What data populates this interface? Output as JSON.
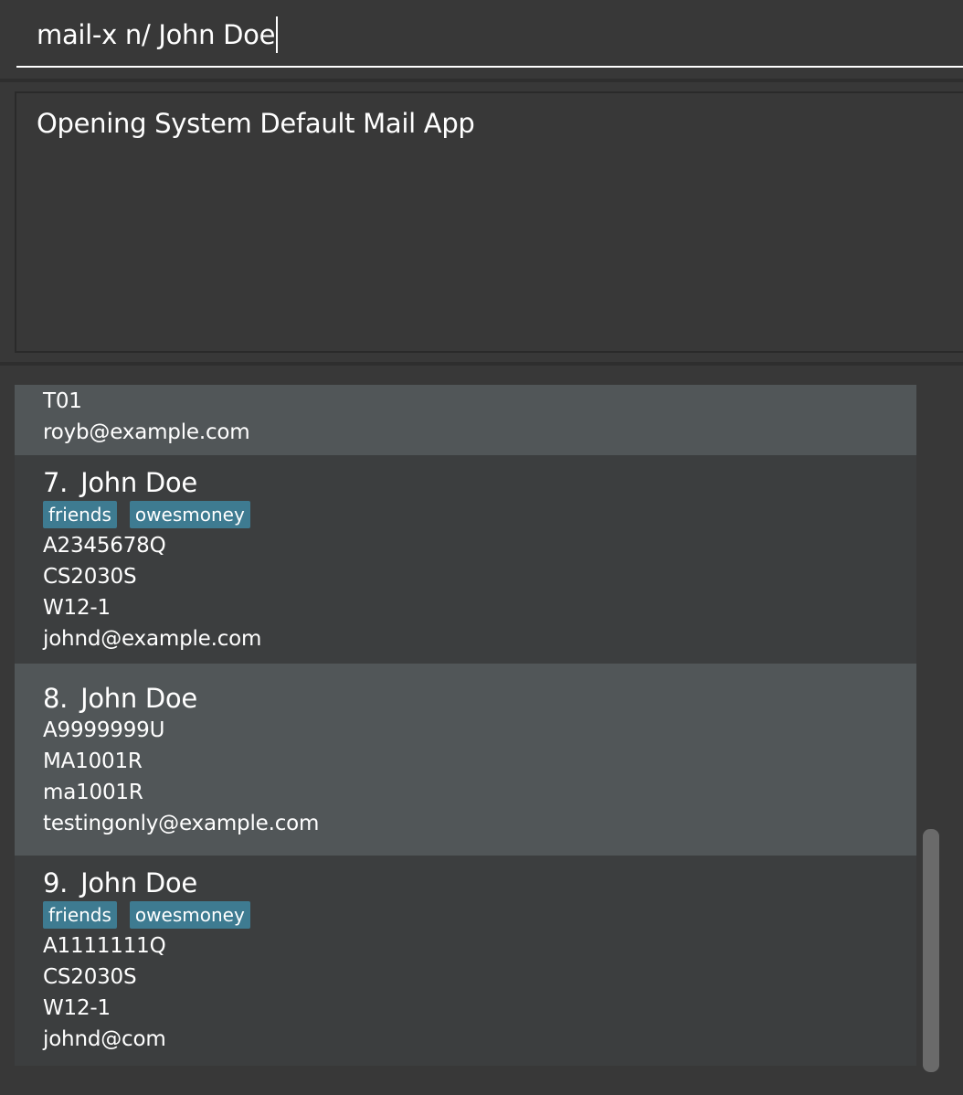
{
  "command_box": {
    "value": "mail-x n/ John Doe"
  },
  "result_display": {
    "message": "Opening System Default Mail App"
  },
  "person_list": {
    "partial_card": {
      "fields": [
        "T01",
        "royb@example.com"
      ]
    },
    "cards": [
      {
        "index": "7.",
        "name": "John Doe",
        "tags": [
          "friends",
          "owesmoney"
        ],
        "student_id": "A2345678Q",
        "module": "CS2030S",
        "tutorial": "W12-1",
        "email": "johnd@example.com"
      },
      {
        "index": "8.",
        "name": "John Doe",
        "tags": [],
        "student_id": "A9999999U",
        "module": "MA1001R",
        "tutorial": "ma1001R",
        "email": "testingonly@example.com"
      },
      {
        "index": "9.",
        "name": "John Doe",
        "tags": [
          "friends",
          "owesmoney"
        ],
        "student_id": "A1111111Q",
        "module": "CS2030S",
        "tutorial": "W12-1",
        "email": "johnd@com"
      }
    ]
  },
  "colors": {
    "background": "#383838",
    "card_even": "#515658",
    "card_odd": "#3c3e3f",
    "tag": "#3e7b91",
    "scroll_thumb": "#6a6a6a"
  }
}
